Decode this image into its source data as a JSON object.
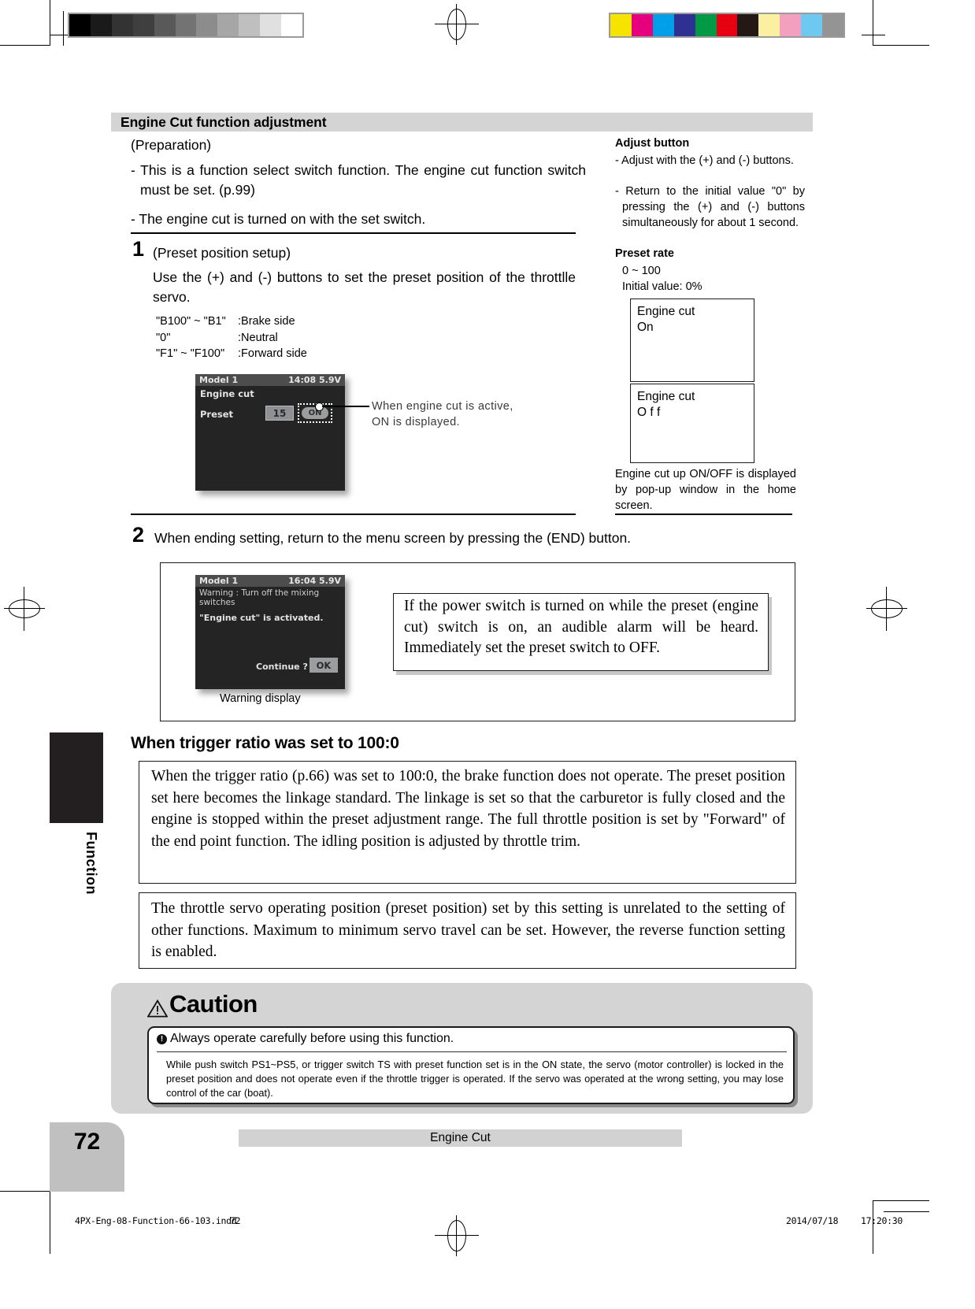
{
  "page": {
    "number": "72",
    "tab_label": "Function",
    "footer_band": "Engine Cut",
    "print_file": "4PX-Eng-08-Function-66-103.indd",
    "print_page": "72",
    "print_date": "2014/07/18",
    "print_time": "17:20:30"
  },
  "section": {
    "title": "Engine Cut function adjustment",
    "preparation_label": "(Preparation)",
    "prep_items": [
      "- This is a function select switch function. The engine cut function switch must be set. (p.99)",
      "- The engine cut is turned on with the set switch."
    ]
  },
  "step1": {
    "number": "1",
    "subtitle": "(Preset position setup)",
    "text": "Use the (+) and (-) buttons to set the preset position of the throttlle servo.",
    "range_rows": [
      {
        "range": "\"B100\" ~ \"B1\"",
        "desc": ":Brake side"
      },
      {
        "range": "\"0\"",
        "desc": ":Neutral"
      },
      {
        "range": "\"F1\" ~ \"F100\"",
        "desc": ":Forward side"
      }
    ],
    "callout": "When engine cut is active,\nON is displayed."
  },
  "step2": {
    "number": "2",
    "text": "When ending setting, return to the menu screen by pressing the (END) button.",
    "caption": "Warning display",
    "note": "If the power switch is turned on while the preset (engine cut) switch is on, an audible alarm will be heard. Immediately set the preset switch to OFF."
  },
  "lcd_preset": {
    "model": "Model 1",
    "status": "14:08 5.9V",
    "title": "Engine cut",
    "row_label": "Preset",
    "value": "15",
    "toggle": "ON"
  },
  "lcd_warning": {
    "model": "Model 1",
    "status": "16:04 5.9V",
    "line1": "Warning : Turn off the mixing switches",
    "line2": "\"Engine cut\" is activated.",
    "prompt": "Continue ?",
    "ok": "OK"
  },
  "sidebar": {
    "adjust_button_title": "Adjust button",
    "adjust_items": [
      "- Adjust with the (+) and (-) buttons.",
      "- Return to the initial value \"0\" by pressing the (+) and (-) buttons simultaneously for about 1 second."
    ],
    "preset_rate_title": "Preset rate",
    "preset_rate_range": "0 ~ 100",
    "preset_rate_initial": "Initial value: 0%",
    "box_on": {
      "line1": "Engine cut",
      "line2": "On"
    },
    "box_off": {
      "line1": "Engine cut",
      "line2": "O f f"
    },
    "box_caption": "Engine cut up ON/OFF is displayed by pop-up window in the home screen."
  },
  "trigger": {
    "heading": "When trigger ratio was set to 100:0",
    "para1": "When the trigger ratio (p.66) was set to 100:0, the brake function does not operate. The preset position set here becomes the linkage standard. The linkage is set so that the carburetor is fully closed and the engine is stopped within the preset adjustment range. The full throttle position is set by \"Forward\" of the end point function. The idling position is adjusted by throttle trim.",
    "para2": "The throttle servo operating position (preset position) set by this setting is unrelated to the setting of other functions. Maximum to minimum servo travel can be set. However, the reverse function setting is enabled."
  },
  "caution": {
    "title": "Caution",
    "headline": "Always operate carefully before using this function.",
    "body": "While push switch PS1~PS5, or trigger switch TS with preset function set is in the ON state, the servo (motor controller) is locked in the preset position and does not operate even if the throttle trigger is operated. If the servo was operated at the wrong setting, you may lose control of the car (boat)."
  },
  "calibration": {
    "gray_swatches": [
      "#000000",
      "#1a1a1a",
      "#333333",
      "#3f3f3f",
      "#595959",
      "#737373",
      "#8c8c8c",
      "#a6a6a6",
      "#bfbfbf",
      "#e0e0e0",
      "#ffffff"
    ],
    "color_swatches": [
      "#f5e400",
      "#e6007e",
      "#00a0e9",
      "#2e3192",
      "#009944",
      "#e60012",
      "#231815",
      "#faf0a0",
      "#f3a0be",
      "#6ec9f0",
      "#949495"
    ]
  }
}
